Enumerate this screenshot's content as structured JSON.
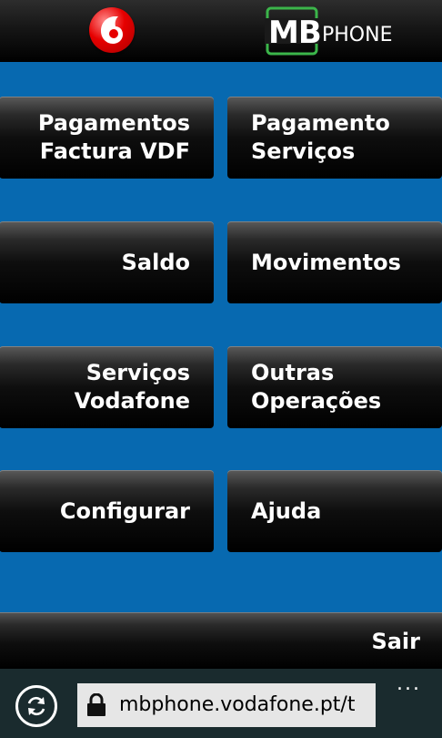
{
  "header": {
    "operator_logo": "vodafone-logo",
    "brand_mb": "MB",
    "brand_phone": "PHONE",
    "brand_color": "#3bb54a"
  },
  "menu": {
    "tiles": [
      {
        "label": "Pagamentos\nFactura VDF"
      },
      {
        "label": "Pagamento\nServiços"
      },
      {
        "label": "Saldo"
      },
      {
        "label": "Movimentos"
      },
      {
        "label": "Serviços\nVodafone"
      },
      {
        "label": "Outras\nOperações"
      },
      {
        "label": "Configurar"
      },
      {
        "label": "Ajuda"
      }
    ]
  },
  "footer": {
    "exit_label": "Sair"
  },
  "browser": {
    "url": "mbphone.vodafone.pt/t",
    "more_label": "...",
    "refresh_icon": "refresh-icon",
    "lock_icon": "lock-icon"
  },
  "colors": {
    "background_blue": "#0769b0",
    "tile_black": "#000000",
    "vodafone_red": "#e60000",
    "browser_bar": "#1a2b2e"
  }
}
